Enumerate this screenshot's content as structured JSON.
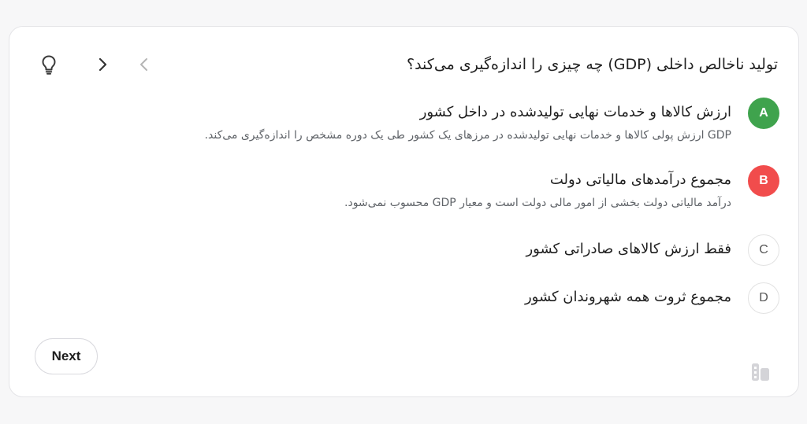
{
  "quiz": {
    "question": "تولید ناخالص داخلی (GDP) چه چیزی را اندازه‌گیری می‌کند؟",
    "icons": {
      "hint": "lightbulb-icon",
      "next": "chevron-right-icon",
      "previous": "chevron-left-icon",
      "brand": "app-logo-icon"
    },
    "options": [
      {
        "letter": "A",
        "text": "ارزش کالاها و خدمات نهایی تولیدشده در داخل کشور",
        "explanation": "GDP ارزش پولی کالاها و خدمات نهایی تولیدشده در مرزهای یک کشور طی یک دوره مشخص را اندازه‌گیری می‌کند.",
        "state": "correct"
      },
      {
        "letter": "B",
        "text": "مجموع درآمدهای مالیاتی دولت",
        "explanation": "درآمد مالیاتی دولت بخشی از امور مالی دولت است و معیار GDP محسوب نمی‌شود.",
        "state": "wrong"
      },
      {
        "letter": "C",
        "text": "فقط ارزش کالاهای صادراتی کشور",
        "explanation": "",
        "state": "neutral"
      },
      {
        "letter": "D",
        "text": "مجموع ثروت همه شهروندان کشور",
        "explanation": "",
        "state": "neutral"
      }
    ],
    "next_label": "Next"
  },
  "colors": {
    "correct": "#3fa34d",
    "wrong": "#f14c4c",
    "border": "#e4e4e7",
    "background": "#f7f7f8"
  }
}
